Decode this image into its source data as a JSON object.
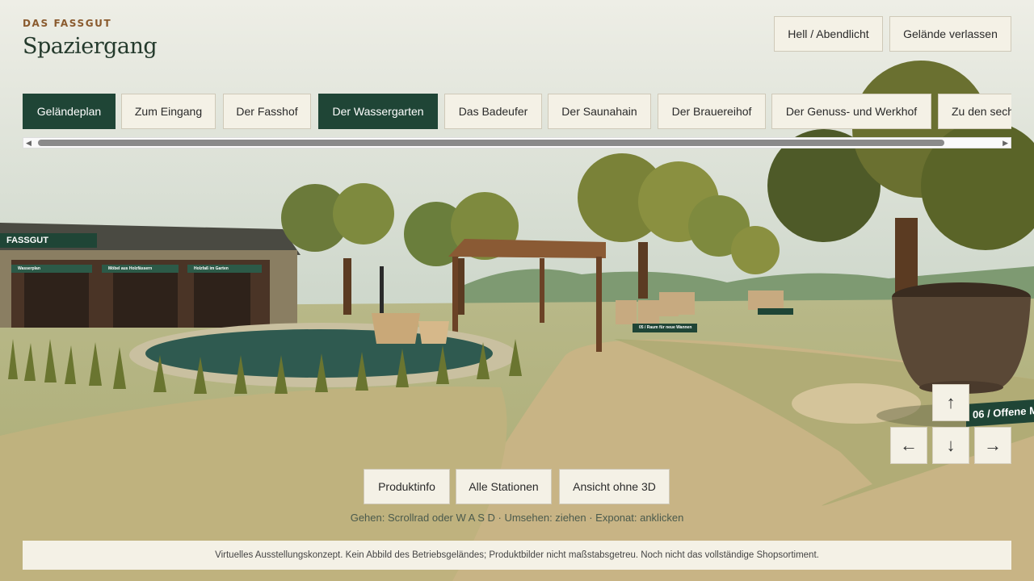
{
  "header": {
    "brand": "DAS FASSGUT",
    "title": "Spaziergang"
  },
  "top_actions": {
    "light_toggle": "Hell / Abendlicht",
    "leave": "Gelände verlassen"
  },
  "tabs": [
    {
      "label": "Geländeplan",
      "active": true
    },
    {
      "label": "Zum Eingang",
      "active": false
    },
    {
      "label": "Der Fasshof",
      "active": false
    },
    {
      "label": "Der Wassergarten",
      "active": true
    },
    {
      "label": "Das Badeufer",
      "active": false
    },
    {
      "label": "Der Saunahain",
      "active": false
    },
    {
      "label": "Der Brauereihof",
      "active": false
    },
    {
      "label": "Der Genuss- und Werkhof",
      "active": false
    },
    {
      "label": "Zu den sech",
      "active": false
    }
  ],
  "scene": {
    "building_sign": "FASSGUT",
    "building_panels": [
      "Wasserplan",
      "Möbel aus Holzfässern",
      "Holzfaß im Garten"
    ],
    "station_label": "05 / Raum für neue Wannen",
    "side_sign": "06 / Offene M"
  },
  "nav_arrows": {
    "up": "↑",
    "left": "←",
    "down": "↓",
    "right": "→"
  },
  "bottom_actions": {
    "product_info": "Produktinfo",
    "all_stations": "Alle Stationen",
    "view_no_3d": "Ansicht ohne 3D"
  },
  "hint": "Gehen: Scrollrad oder W A S D · Umsehen: ziehen · Exponat: anklicken",
  "footer": "Virtuelles Ausstellungskonzept. Kein Abbild des Betriebsgeländes; Produktbilder nicht maßstabsgetreu. Noch nicht das vollständige Shopsortiment.",
  "colors": {
    "accent": "#1f4536",
    "button_bg": "#f4f1e6",
    "brand": "#8a5a2e"
  }
}
